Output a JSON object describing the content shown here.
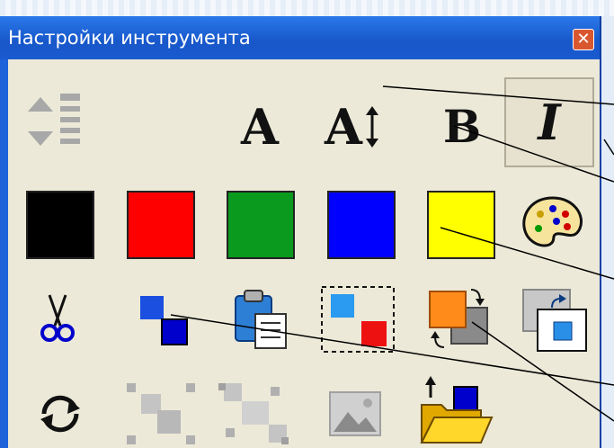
{
  "window": {
    "title": "Настройки инструмента",
    "close_label": "✕"
  },
  "text_buttons": {
    "font_a": "A",
    "font_size_a": "A",
    "bold": "B",
    "italic": "I"
  },
  "colors": {
    "black": "#000000",
    "red": "#ff0000",
    "green": "#0a9a1e",
    "blue": "#0000ff",
    "yellow": "#ffff00",
    "panel": "#ece9d8",
    "titlebar": "#1d62d8"
  },
  "icons": {
    "row1": [
      "line-spacing-icon",
      "font-icon",
      "font-size-icon",
      "bold-icon",
      "italic-icon"
    ],
    "row2": [
      "color-black",
      "color-red",
      "color-green",
      "color-blue",
      "color-yellow",
      "palette-icon"
    ],
    "row3": [
      "scissors-icon",
      "copy-icon",
      "paste-icon",
      "select-icon",
      "flip-icon",
      "rotate-icon"
    ],
    "row4": [
      "refresh-icon",
      "shrink-icon",
      "expand-icon",
      "picture-icon",
      "open-folder-icon"
    ]
  }
}
